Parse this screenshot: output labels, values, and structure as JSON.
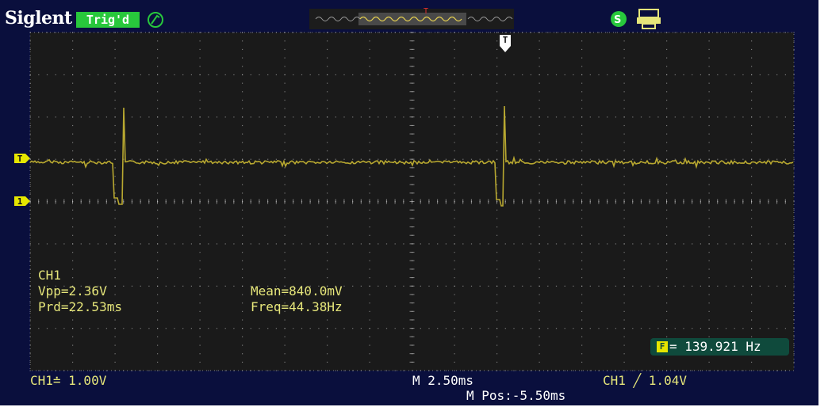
{
  "header": {
    "brand": "Siglent",
    "trigger_status": "Trig'd"
  },
  "markers": {
    "trigger_level": "T",
    "channel_1": "1",
    "trigger_position": "T"
  },
  "measurements": {
    "channel": "CH1",
    "vpp": "Vpp=2.36V",
    "period": "Prd=22.53ms",
    "mean": "Mean=840.0mV",
    "frequency": "Freq=44.38Hz"
  },
  "counter": {
    "value": "= 139.921 Hz"
  },
  "footer": {
    "ch1_scale": "CH1≐ 1.00V",
    "timebase": "M 2.50ms",
    "m_pos": "M Pos:-5.50ms",
    "trigger_info": "CH1 ╱ 1.04V"
  },
  "colors": {
    "trace": "#b8a830",
    "background": "#0a0f3d",
    "grid": "#c8c8c8",
    "label": "#e6e67a"
  }
}
